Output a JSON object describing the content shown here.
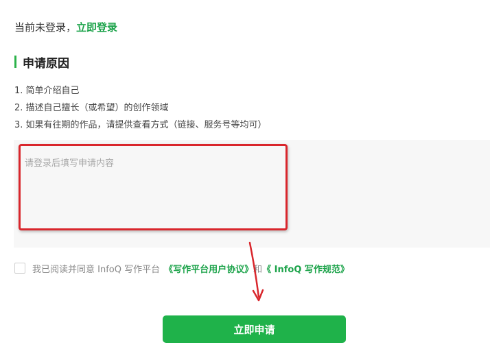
{
  "login": {
    "status_text": "当前未登录，",
    "login_link": "立即登录"
  },
  "section": {
    "title": "申请原因"
  },
  "guidelines": [
    "1. 简单介绍自己",
    "2. 描述自己擅长（或希望）的创作领域",
    "3. 如果有往期的作品，请提供查看方式（链接、服务号等均可）"
  ],
  "application_input": {
    "placeholder": "请登录后填写申请内容"
  },
  "agreement": {
    "prefix": "我已阅读并同意 InfoQ 写作平台",
    "user_agreement_link": "《写作平台用户协议》",
    "conjunction": "和",
    "writing_rules_link": "《 InfoQ 写作规范》"
  },
  "submit_button": {
    "label": "立即申请"
  },
  "colors": {
    "brand_green": "#1fb24a",
    "annotation_red": "#d9262c"
  }
}
